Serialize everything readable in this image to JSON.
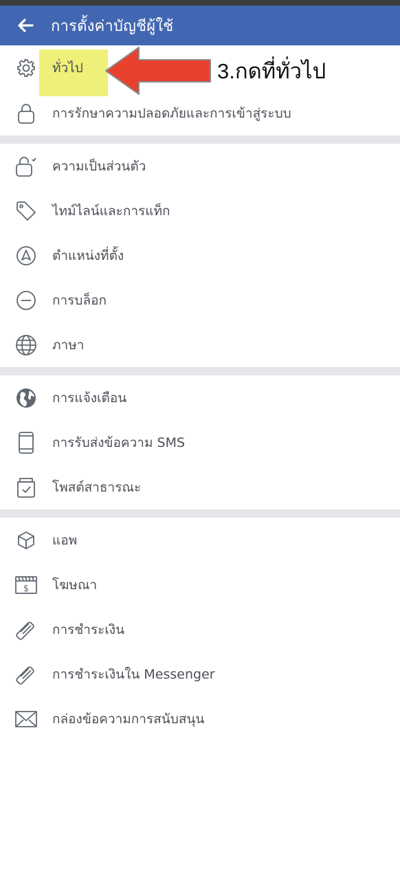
{
  "header": {
    "title": "การตั้งค่าบัญชีผู้ใช้",
    "back_icon": "arrow-left-icon"
  },
  "annotation": {
    "text": "3.กดที่ทั่วไป",
    "arrow_color": "#e8412e",
    "highlight_color": "#eef07a"
  },
  "colors": {
    "header_bg": "#4267b2",
    "separator": "#e4e6ea",
    "label": "#4b4f56",
    "icon": "#606770"
  },
  "sections": [
    {
      "items": [
        {
          "label": "ทั่วไป",
          "icon": "gear-icon"
        },
        {
          "label": "การรักษาความปลอดภัยและการเข้าสู่ระบบ",
          "icon": "lock-icon"
        }
      ]
    },
    {
      "items": [
        {
          "label": "ความเป็นส่วนตัว",
          "icon": "privacy-lock-icon"
        },
        {
          "label": "ไทม์ไลน์และการแท็ก",
          "icon": "tag-icon"
        },
        {
          "label": "ตำแหน่งที่ตั้ง",
          "icon": "location-icon"
        },
        {
          "label": "การบล็อก",
          "icon": "block-icon"
        },
        {
          "label": "ภาษา",
          "icon": "globe-icon"
        }
      ]
    },
    {
      "items": [
        {
          "label": "การแจ้งเตือน",
          "icon": "world-icon"
        },
        {
          "label": "การรับส่งข้อความ SMS",
          "icon": "phone-icon"
        },
        {
          "label": "โพสต์สาธารณะ",
          "icon": "public-post-icon"
        }
      ]
    },
    {
      "items": [
        {
          "label": "แอพ",
          "icon": "cube-icon"
        },
        {
          "label": "โฆษณา",
          "icon": "ads-icon"
        },
        {
          "label": "การชำระเงิน",
          "icon": "card-icon"
        },
        {
          "label": "การชำระเงินใน Messenger",
          "icon": "card-icon"
        },
        {
          "label": "กล่องข้อความการสนับสนุน",
          "icon": "envelope-icon"
        }
      ]
    }
  ]
}
